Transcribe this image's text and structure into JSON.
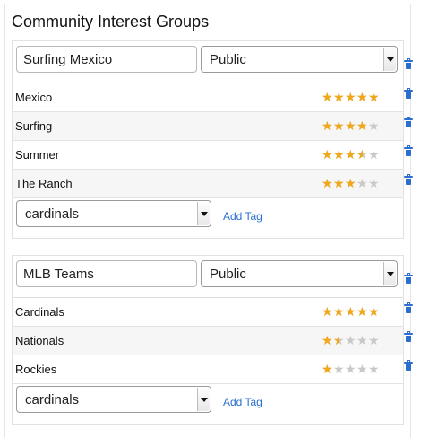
{
  "page": {
    "title": "Community Interest Groups"
  },
  "colors": {
    "accent": "#2a6fd0",
    "star_on": "#f0a81a",
    "star_off": "#c9c9c9"
  },
  "icons": {
    "delete": "trash-icon",
    "rating": "star-icon",
    "dropdown": "chevron-down-icon"
  },
  "groups": [
    {
      "name": "Surfing Mexico",
      "visibility": "Public",
      "tags": [
        {
          "label": "Mexico",
          "rating": 5
        },
        {
          "label": "Surfing",
          "rating": 4
        },
        {
          "label": "Summer",
          "rating": 3.5
        },
        {
          "label": "The Ranch",
          "rating": 3
        }
      ],
      "tag_select_value": "cardinals",
      "add_tag_label": "Add Tag"
    },
    {
      "name": "MLB Teams",
      "visibility": "Public",
      "tags": [
        {
          "label": "Cardinals",
          "rating": 5
        },
        {
          "label": "Nationals",
          "rating": 1.5
        },
        {
          "label": "Rockies",
          "rating": 1
        }
      ],
      "tag_select_value": "cardinals",
      "add_tag_label": "Add Tag"
    }
  ]
}
